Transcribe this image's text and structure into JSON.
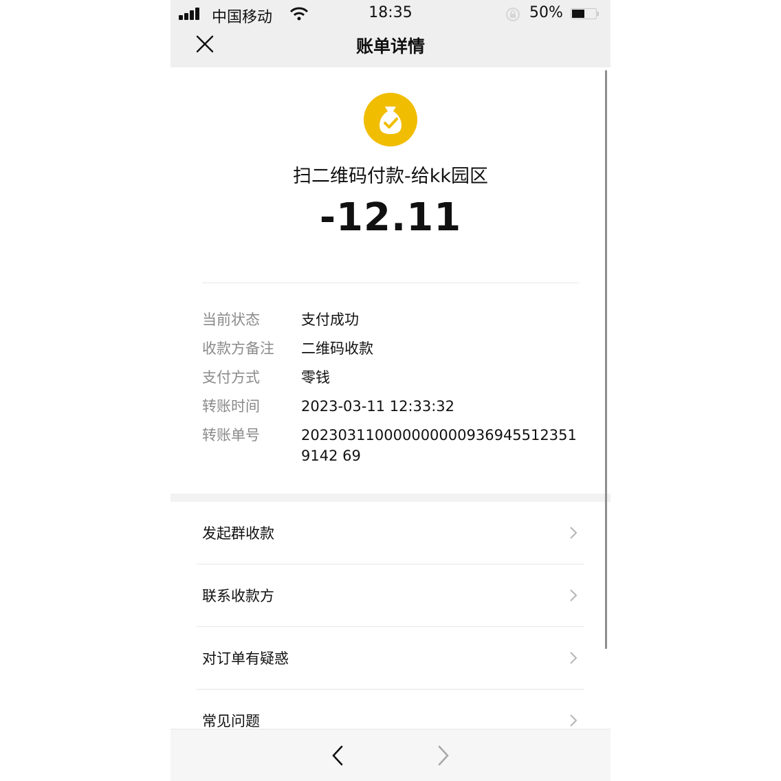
{
  "status_bar": {
    "carrier": "中国移动",
    "time": "18:35",
    "battery_percent": "50%",
    "battery_level": 0.5
  },
  "nav": {
    "title": "账单详情",
    "close_icon": "close-icon"
  },
  "summary": {
    "icon": "money-bag-check-icon",
    "icon_color": "#f0bd00",
    "merchant": "扫二维码付款-给kk园区",
    "amount": "-12.11"
  },
  "details": [
    {
      "label": "当前状态",
      "value": "支付成功"
    },
    {
      "label": "收款方备注",
      "value": "二维码收款"
    },
    {
      "label": "支付方式",
      "value": "零钱"
    },
    {
      "label": "转账时间",
      "value": "2023-03-11 12:33:32"
    },
    {
      "label": "转账单号",
      "value": "2023031100000000009369455123519142 69"
    }
  ],
  "menu": [
    {
      "label": "发起群收款"
    },
    {
      "label": "联系收款方"
    },
    {
      "label": "对订单有疑惑"
    },
    {
      "label": "常见问题"
    }
  ],
  "bottom_bar": {
    "back_icon": "chevron-left-icon",
    "forward_icon": "chevron-right-icon"
  }
}
